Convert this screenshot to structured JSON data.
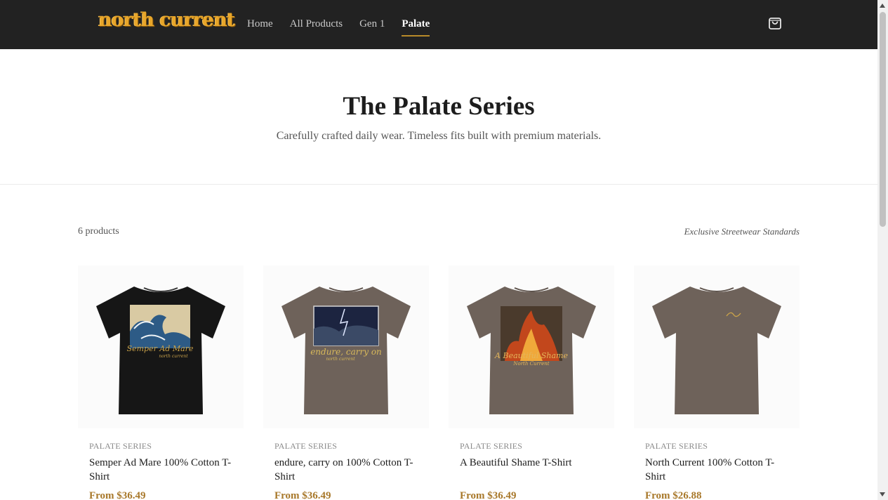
{
  "header": {
    "logo": "north current",
    "nav": [
      "Home",
      "All Products",
      "Gen 1",
      "Palate"
    ],
    "active_nav": "Palate",
    "cart_icon": "shopping-bag-icon"
  },
  "hero": {
    "title": "The Palate Series",
    "subtitle": "Carefully crafted daily wear. Timeless fits built with premium materials."
  },
  "toolbar": {
    "count": "6 products",
    "tagline": "Exclusive Streetwear Standards"
  },
  "products": [
    {
      "series": "PALATE SERIES",
      "name": "Semper Ad Mare 100% Cotton T-Shirt",
      "price": "From $36.49",
      "shirt_color": "#161616",
      "print_text": "Semper Ad Mare",
      "print_sub": "north current",
      "print_art": "wave"
    },
    {
      "series": "PALATE SERIES",
      "name": "endure, carry on 100% Cotton T-Shirt",
      "price": "From $36.49",
      "shirt_color": "#6e625a",
      "print_text": "endure, carry on",
      "print_sub": "north current",
      "print_art": "storm"
    },
    {
      "series": "PALATE SERIES",
      "name": "A Beautiful Shame T-Shirt",
      "price": "From $36.49",
      "shirt_color": "#6e625a",
      "print_text": "A Beautiful Shame",
      "print_sub": "North Current",
      "print_art": "fire"
    },
    {
      "series": "PALATE SERIES",
      "name": "North Current 100% Cotton T-Shirt",
      "price": "From $26.88",
      "shirt_color": "#6e625a",
      "print_text": "",
      "print_sub": "",
      "print_art": "chest-logo"
    }
  ],
  "colors": {
    "accent": "#b88a2a",
    "price": "#a8782a",
    "header_bg": "#222222",
    "logo": "#e8a62a"
  }
}
